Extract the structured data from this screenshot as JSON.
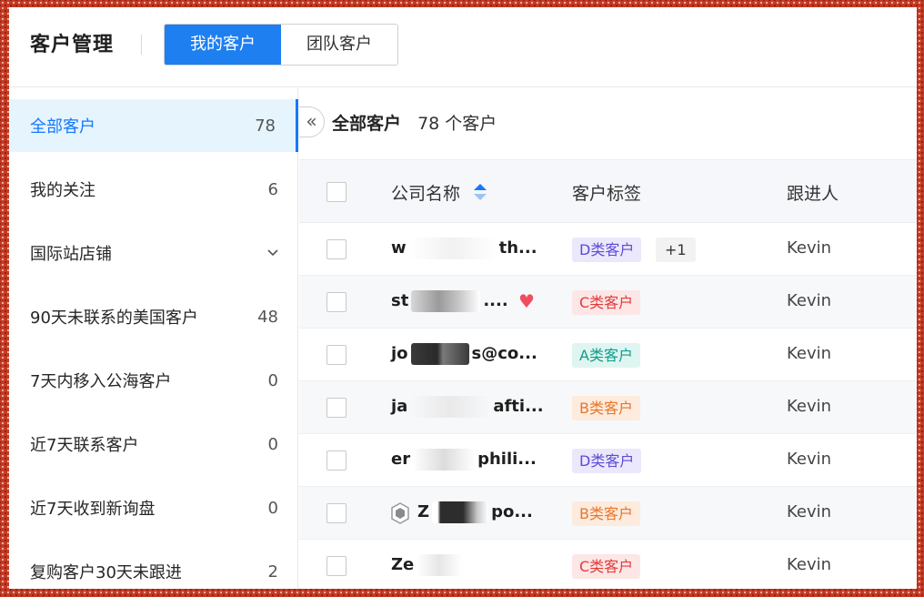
{
  "app": {
    "title": "客户管理"
  },
  "tabs": [
    {
      "label": "我的客户",
      "active": true
    },
    {
      "label": "团队客户",
      "active": false
    }
  ],
  "sidebar": {
    "items": [
      {
        "label": "全部客户",
        "count": "78",
        "active": true
      },
      {
        "label": "我的关注",
        "count": "6"
      },
      {
        "label": "国际站店铺",
        "count": "",
        "icon": "chevron-down-icon"
      },
      {
        "label": "90天未联系的美国客户",
        "count": "48"
      },
      {
        "label": "7天内移入公海客户",
        "count": "0"
      },
      {
        "label": "近7天联系客户",
        "count": "0"
      },
      {
        "label": "近7天收到新询盘",
        "count": "0"
      },
      {
        "label": "复购客户30天未跟进",
        "count": "2"
      }
    ]
  },
  "main": {
    "collapse_icon": "double-chevron-left-icon",
    "breadcrumb": {
      "title": "全部客户",
      "count_text": "78 个客户"
    },
    "columns": {
      "company": "公司名称",
      "tags": "客户标签",
      "owner": "跟进人"
    },
    "rows": [
      {
        "company_start": "w",
        "company_end": "th...",
        "tag": "D类客户",
        "tag_class": "d",
        "extra_tag": "+1",
        "owner": "Kevin"
      },
      {
        "company_start": "st",
        "company_end": "....",
        "tag": "C类客户",
        "tag_class": "c",
        "favorite": true,
        "owner": "Kevin"
      },
      {
        "company_start": "jo",
        "company_end": "s@co...",
        "tag": "A类客户",
        "tag_class": "a",
        "owner": "Kevin"
      },
      {
        "company_start": "ja",
        "company_end": "afti...",
        "tag": "B类客户",
        "tag_class": "b",
        "owner": "Kevin"
      },
      {
        "company_start": "er",
        "company_end": "phili...",
        "tag": "D类客户",
        "tag_class": "d",
        "owner": "Kevin"
      },
      {
        "company_start": "Z",
        "company_end": "po...",
        "tag": "B类客户",
        "tag_class": "b",
        "verified": true,
        "owner": "Kevin"
      },
      {
        "company_start": "Ze",
        "company_end": "",
        "tag": "C类客户",
        "tag_class": "c",
        "owner": "Kevin"
      }
    ]
  },
  "colors": {
    "primary": "#1e7ff0",
    "frame": "#c43a25"
  }
}
